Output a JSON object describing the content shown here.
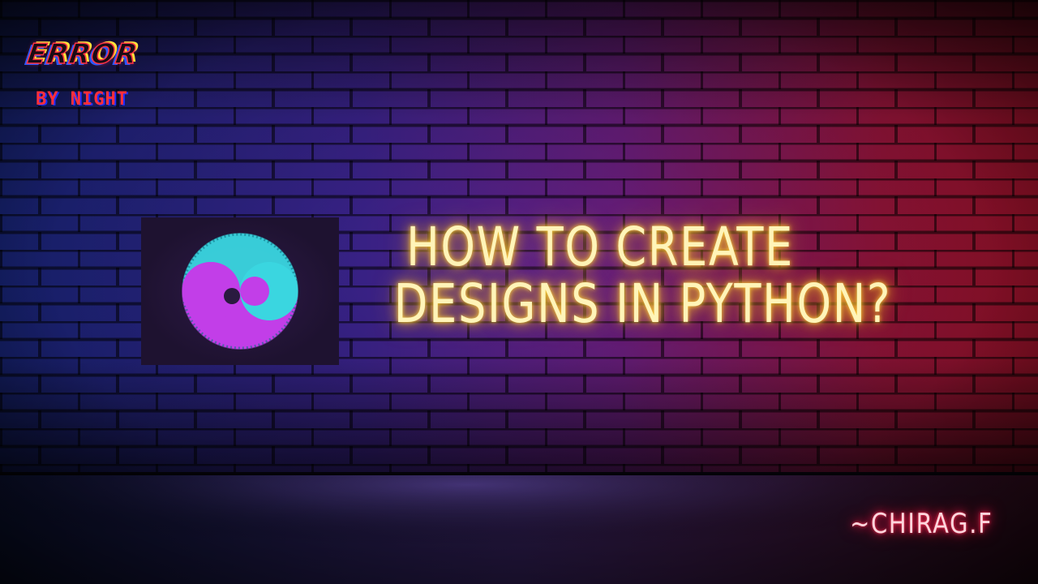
{
  "logo": {
    "line1": "ERROR",
    "line2": "BY NIGHT"
  },
  "headline": {
    "line1": "HOW TO CREATE",
    "line2": "DESIGNS IN PYTHON?"
  },
  "author": "~CHIRAG.F",
  "thumbnail_icon": "spiral-swirl-icon",
  "colors": {
    "wall_left": "#1f2a8a",
    "wall_mid": "#5a1f7a",
    "wall_right": "#a0143e",
    "headline_glow": "#f5b823",
    "author_glow": "#ff1f4b",
    "swirl_cyan": "#3ad6e0",
    "swirl_magenta": "#c23ee8",
    "thumbnail_bg": "#241638"
  }
}
